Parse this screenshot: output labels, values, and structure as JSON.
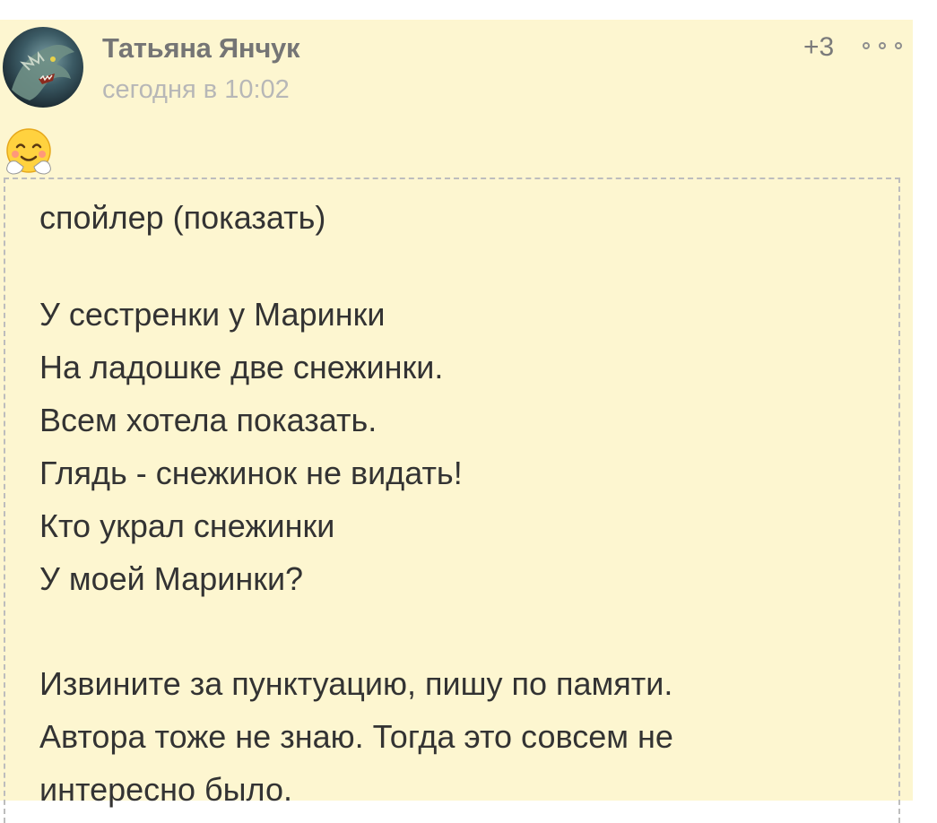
{
  "comment": {
    "author": "Татьяна Янчук",
    "timestamp": "сегодня в 10:02",
    "rating": "+3",
    "emoji_icon": "hugging-face-emoji",
    "colors": {
      "background": "#fdf6d0",
      "author": "#757575",
      "timestamp": "#b7b7b7",
      "text": "#333333"
    }
  },
  "spoiler": {
    "toggle_label": "спойлер (показать)",
    "poem_lines": [
      "У сестренки у Маринки",
      "На ладошке две снежинки.",
      "Всем хотела показать.",
      "Глядь - снежинок не видать!",
      "Кто украл снежинки",
      "У моей Маринки?"
    ],
    "note_lines": [
      "Извините за пунктуацию, пишу по памяти.",
      "Автора тоже не знаю. Тогда это совсем не",
      "интересно было."
    ]
  }
}
